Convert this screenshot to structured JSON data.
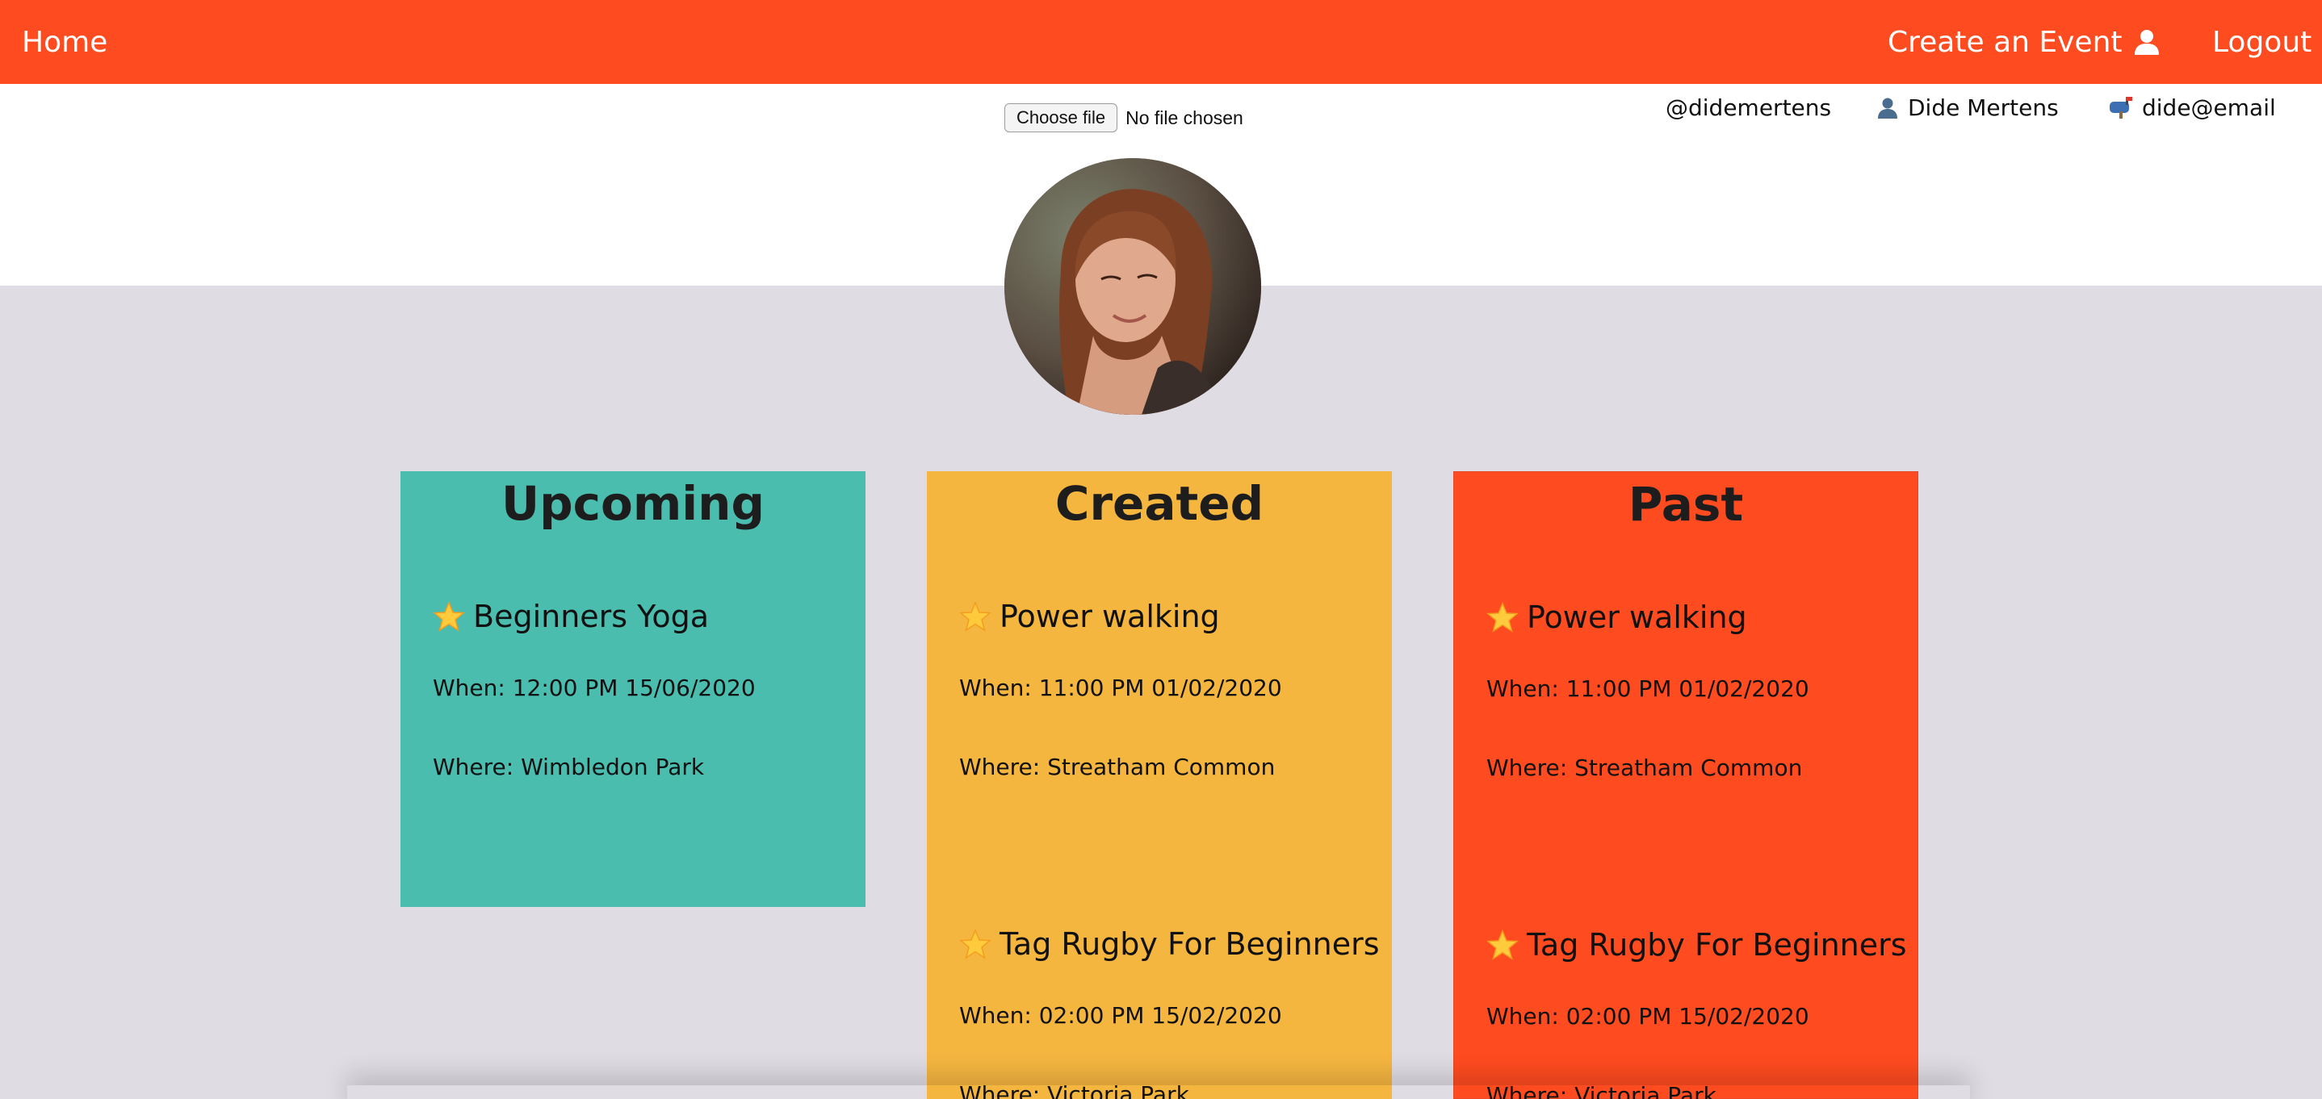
{
  "nav": {
    "home": "Home",
    "create_event": "Create an Event",
    "logout": "Logout"
  },
  "file_picker": {
    "button_label": "Choose file",
    "status": "No file chosen"
  },
  "user": {
    "handle": "@didemertens",
    "name": "Dide Mertens",
    "email": "dide@email"
  },
  "columns": [
    {
      "title": "Upcoming",
      "events": [
        {
          "name": "Beginners Yoga",
          "when": "When: 12:00 PM 15/06/2020",
          "where": "Where: Wimbledon Park"
        }
      ]
    },
    {
      "title": "Created",
      "events": [
        {
          "name": "Power walking",
          "when": "When: 11:00 PM 01/02/2020",
          "where": "Where: Streatham Common"
        },
        {
          "name": "Tag Rugby For Beginners",
          "when": "When: 02:00 PM 15/02/2020",
          "where": "Where: Victoria Park"
        }
      ]
    },
    {
      "title": "Past",
      "events": [
        {
          "name": "Power walking",
          "when": "When: 11:00 PM 01/02/2020",
          "where": "Where: Streatham Common"
        },
        {
          "name": "Tag Rugby For Beginners",
          "when": "When: 02:00 PM 15/02/2020",
          "where": "Where: Victoria Park"
        }
      ]
    }
  ],
  "icons": {
    "profile": "user-icon",
    "name": "person-emoji-icon",
    "email": "mailbox-emoji-icon",
    "event": "star-icon"
  },
  "colors": {
    "brand": "#ff4b20",
    "upcoming": "#4abdae",
    "created": "#f5b640",
    "past": "#ff4b20",
    "background": "#dfdce3"
  }
}
